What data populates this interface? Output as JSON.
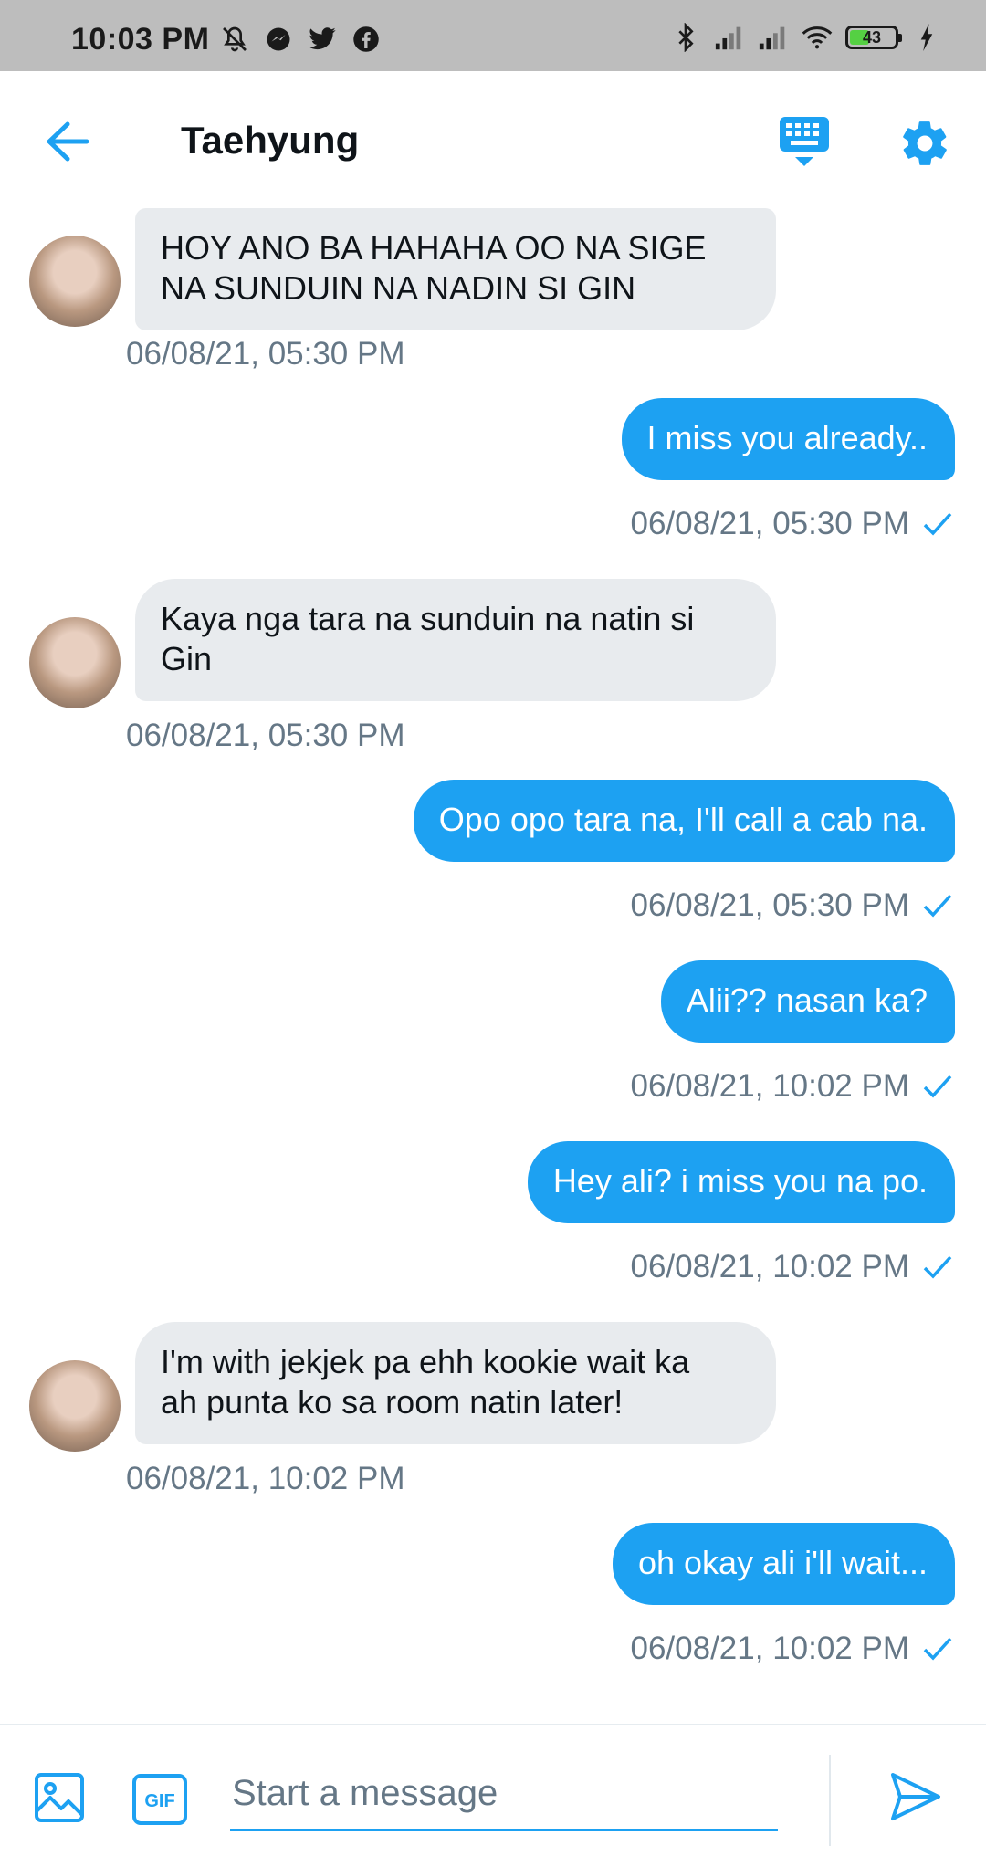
{
  "status_bar": {
    "time": "10:03 PM",
    "battery_level": "43",
    "left_icons": [
      "mute-icon",
      "messenger-icon",
      "twitter-icon",
      "facebook-icon"
    ],
    "right_icons": [
      "bluetooth-icon",
      "signal-icon",
      "signal-icon",
      "wifi-icon",
      "battery-icon",
      "charging-icon"
    ]
  },
  "header": {
    "title": "Taehyung",
    "back_icon": "arrow-left-icon",
    "keyboard_icon": "keyboard-icon",
    "settings_icon": "gear-icon"
  },
  "colors": {
    "accent": "#1da1f2",
    "incoming_bubble": "#e8ebee",
    "timestamp": "#657786",
    "status_bar": "#bdbdbd"
  },
  "messages": [
    {
      "direction": "incoming",
      "text": "HOY ANO BA HAHAHA OO NA SIGE\nNA SUNDUIN NA NADIN SI GIN",
      "timestamp": "06/08/21, 05:30 PM"
    },
    {
      "direction": "outgoing",
      "text": "I miss you already..",
      "timestamp": "06/08/21, 05:30 PM"
    },
    {
      "direction": "incoming",
      "text": "Kaya nga tara na sunduin na natin si\nGin",
      "timestamp": "06/08/21, 05:30 PM"
    },
    {
      "direction": "outgoing",
      "text": "Opo opo tara na, I'll call a cab na.",
      "timestamp": "06/08/21, 05:30 PM"
    },
    {
      "direction": "outgoing",
      "text": "Alii?? nasan ka?",
      "timestamp": "06/08/21, 10:02 PM"
    },
    {
      "direction": "outgoing",
      "text": "Hey ali? i miss you na po.",
      "timestamp": "06/08/21, 10:02 PM"
    },
    {
      "direction": "incoming",
      "text": "I'm with jekjek pa ehh kookie wait ka\nah punta ko sa room natin later!",
      "timestamp": "06/08/21, 10:02 PM"
    },
    {
      "direction": "outgoing",
      "text": "oh okay ali i'll wait...",
      "timestamp": "06/08/21, 10:02 PM"
    }
  ],
  "composer": {
    "placeholder": "Start a message",
    "value": "",
    "gif_label": "GIF"
  }
}
